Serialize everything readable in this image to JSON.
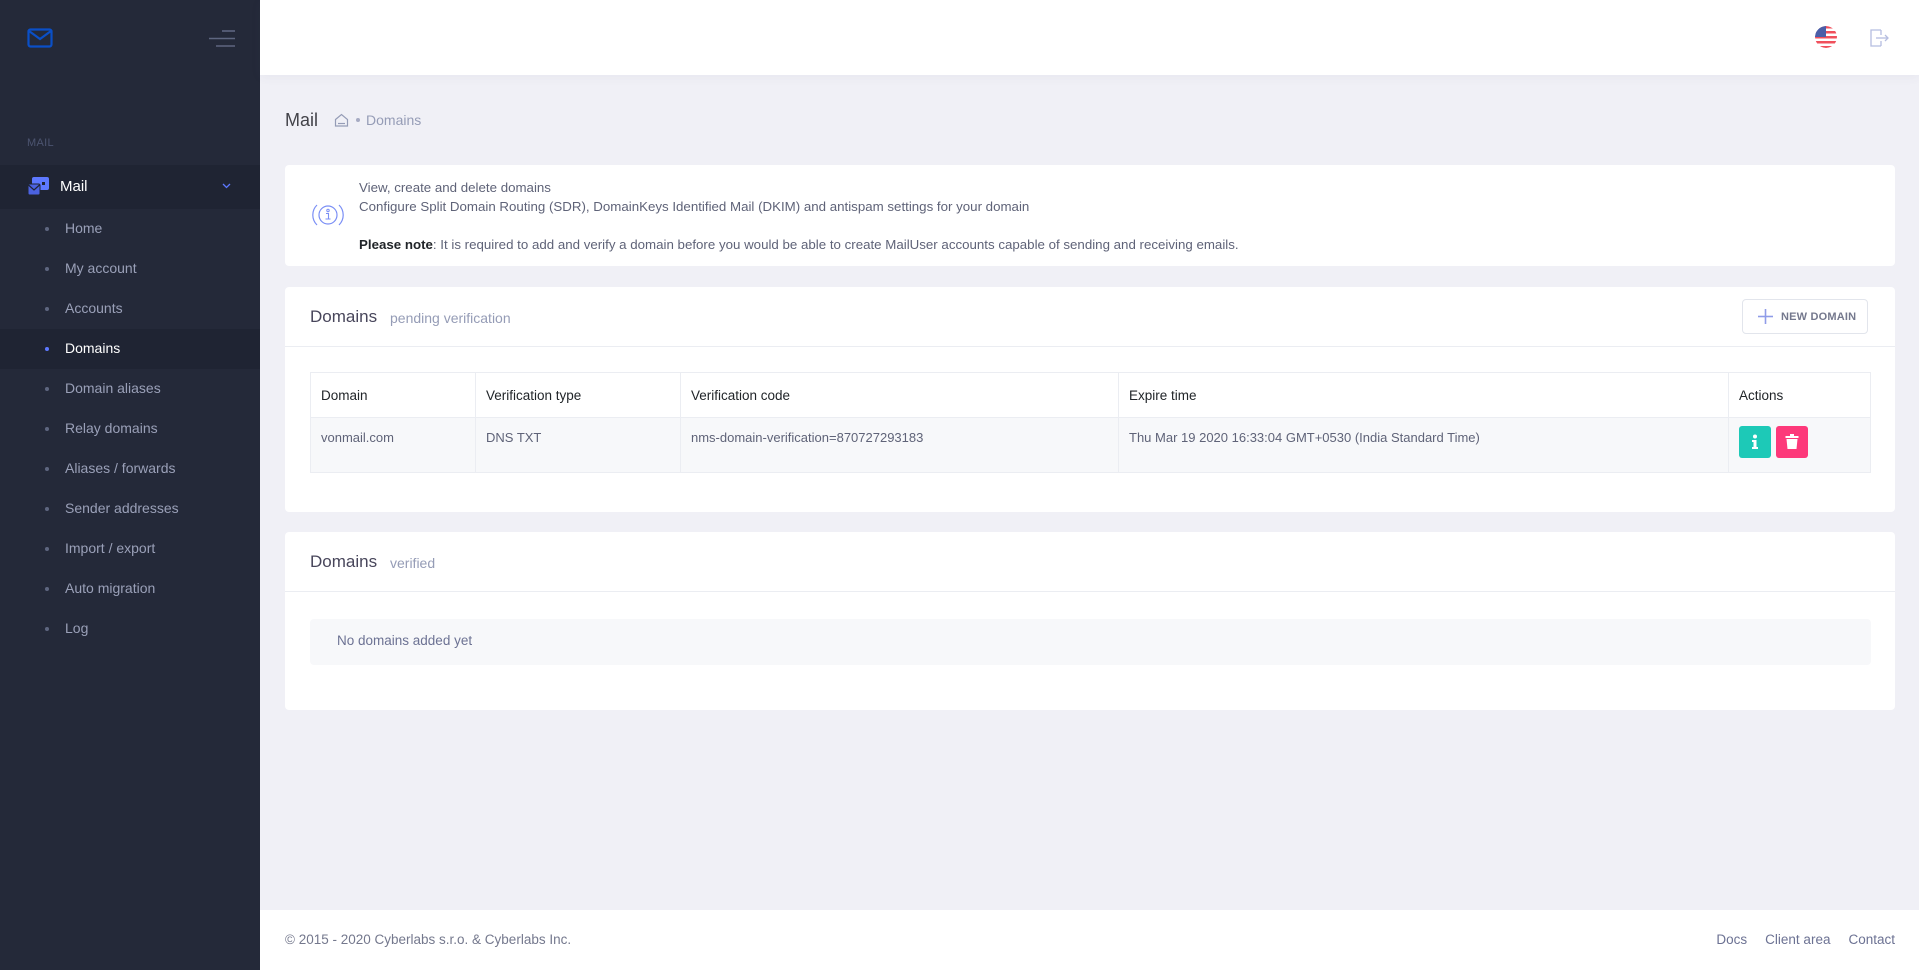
{
  "sidebar": {
    "logo_icon": "envelope-icon",
    "toggle_icon": "hamburger-icon",
    "section_label": "MAIL",
    "parent": {
      "label": "Mail",
      "icon": "mail-stack-icon",
      "chevron": "chevron-down-icon"
    },
    "items": [
      {
        "label": "Home",
        "active": false
      },
      {
        "label": "My account",
        "active": false
      },
      {
        "label": "Accounts",
        "active": false
      },
      {
        "label": "Domains",
        "active": true
      },
      {
        "label": "Domain aliases",
        "active": false
      },
      {
        "label": "Relay domains",
        "active": false
      },
      {
        "label": "Aliases / forwards",
        "active": false
      },
      {
        "label": "Sender addresses",
        "active": false
      },
      {
        "label": "Import / export",
        "active": false
      },
      {
        "label": "Auto migration",
        "active": false
      },
      {
        "label": "Log",
        "active": false
      }
    ]
  },
  "header": {
    "language_icon": "us-flag-icon",
    "logout_icon": "logout-icon"
  },
  "subheader": {
    "title": "Mail",
    "home_icon": "home-icon",
    "breadcrumb": "Domains"
  },
  "info": {
    "icon": "info-icon",
    "line1": "View, create and delete domains",
    "line2": "Configure Split Domain Routing (SDR), DomainKeys Identified Mail (DKIM) and antispam settings for your domain",
    "note_label": "Please note",
    "note_text": ": It is required to add and verify a domain before you would be able to create MailUser accounts capable of sending and receiving emails."
  },
  "pending": {
    "title": "Domains",
    "subtitle": "pending verification",
    "new_button": "NEW DOMAIN",
    "columns": [
      "Domain",
      "Verification type",
      "Verification code",
      "Expire time",
      "Actions"
    ],
    "rows": [
      {
        "domain": "vonmail.com",
        "type": "DNS TXT",
        "code": "nms-domain-verification=870727293183",
        "expire": "Thu Mar 19 2020 16:33:04 GMT+0530 (India Standard Time)"
      }
    ]
  },
  "verified": {
    "title": "Domains",
    "subtitle": "verified",
    "empty": "No domains added yet"
  },
  "footer": {
    "copyright": "© 2015 - 2020 Cyberlabs s.r.o. & Cyberlabs Inc.",
    "links": [
      "Docs",
      "Client area",
      "Contact"
    ]
  },
  "colors": {
    "sidebar_bg": "#242939",
    "accent": "#5d78ff",
    "info_button": "#1dc9b7",
    "delete_button": "#fd397a"
  }
}
